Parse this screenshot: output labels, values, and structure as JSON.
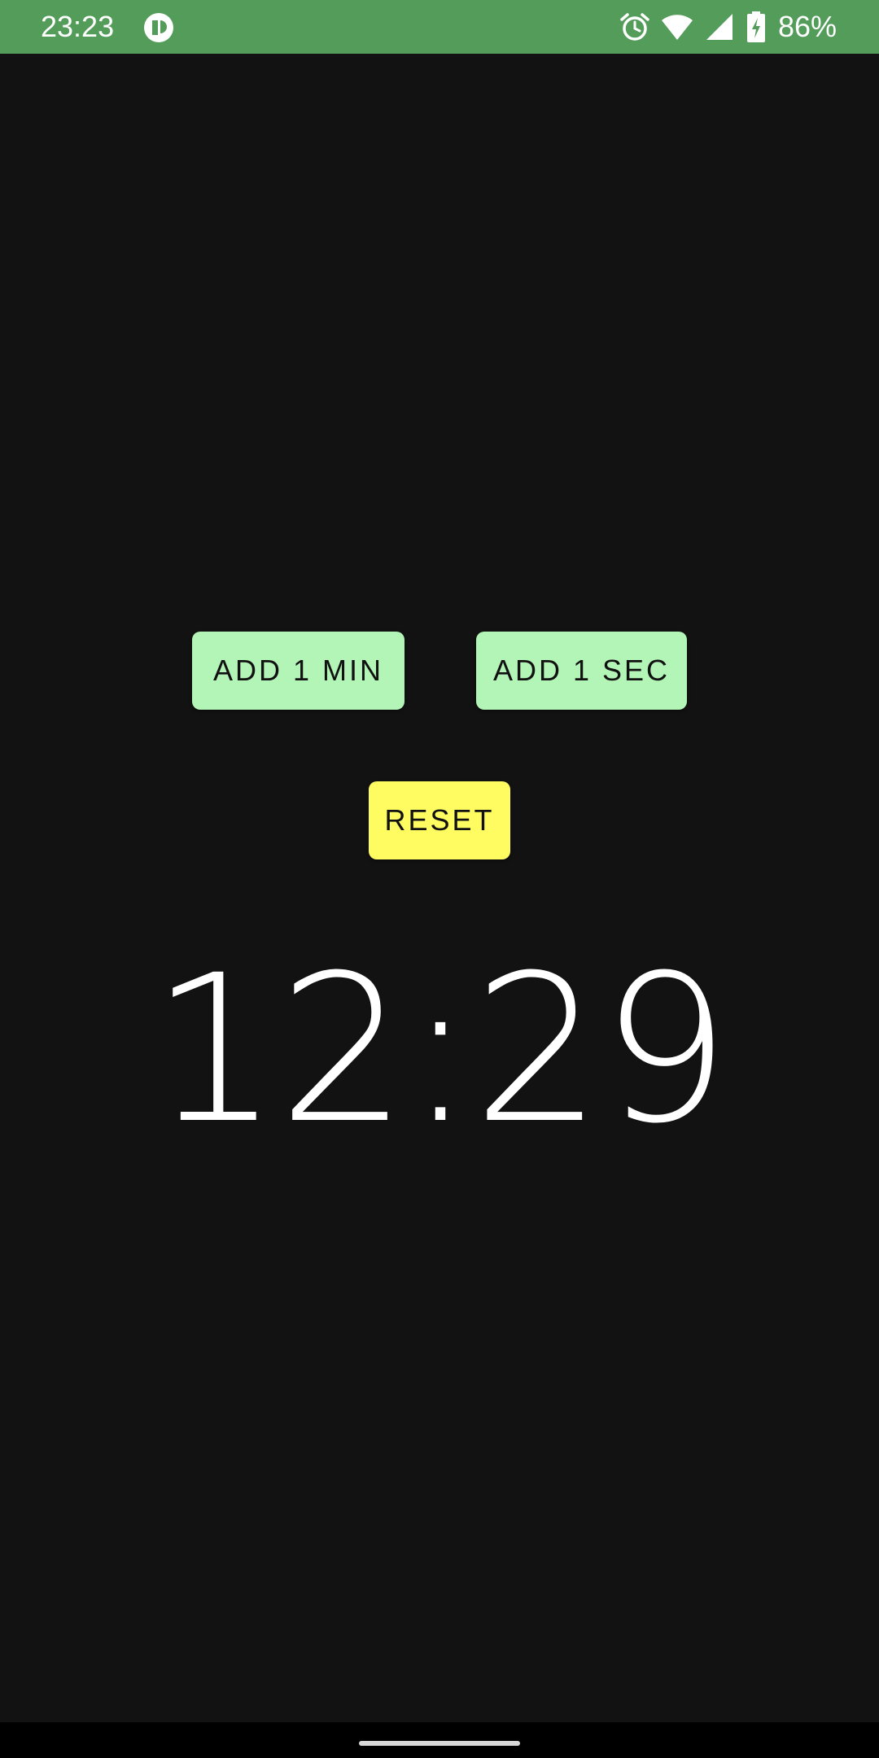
{
  "status_bar": {
    "time": "23:23",
    "battery_percent": "86%",
    "icons": [
      "app-notification-icon",
      "alarm-icon",
      "wifi-icon",
      "cell-signal-icon",
      "battery-charging-icon"
    ],
    "background": "#539C5A"
  },
  "buttons": {
    "add_min_label": "ADD 1 MIN",
    "add_sec_label": "ADD 1 SEC",
    "reset_label": "RESET",
    "add_color": "#B2F5B7",
    "reset_color": "#FFFC62"
  },
  "timer": {
    "display": "12:29"
  },
  "colors": {
    "background": "#121212",
    "text": "#FFFFFF"
  }
}
